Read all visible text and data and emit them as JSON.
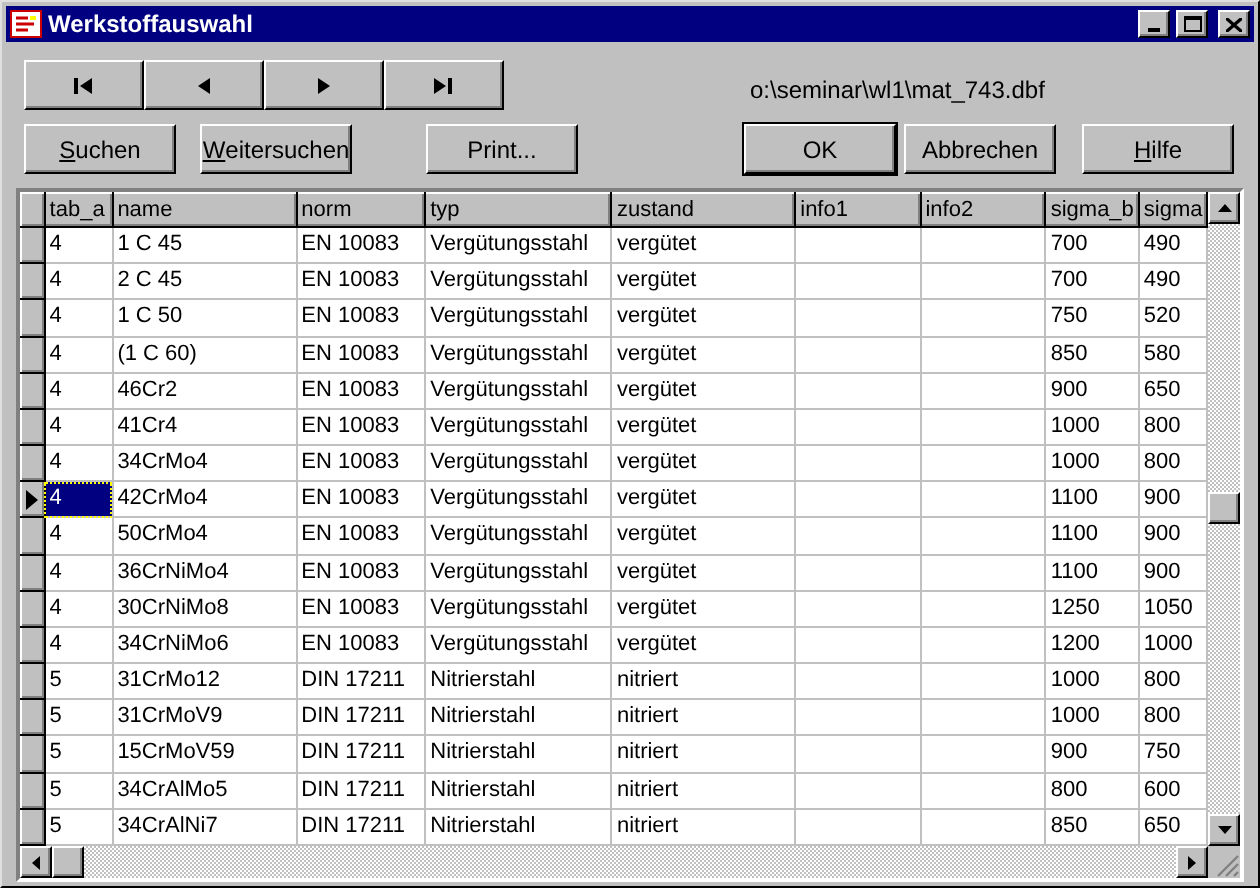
{
  "window": {
    "title": "Werkstoffauswahl"
  },
  "nav_buttons": [
    {
      "kind": "first"
    },
    {
      "kind": "prev"
    },
    {
      "kind": "next"
    },
    {
      "kind": "last"
    }
  ],
  "file_path": "o:\\seminar\\wl1\\mat_743.dbf",
  "left_buttons": [
    {
      "accel": "S",
      "rest": "uchen",
      "default": false
    },
    {
      "accel": "W",
      "rest": "eitersuchen",
      "default": false
    },
    {
      "rest": "Print...",
      "default": false
    }
  ],
  "right_buttons": [
    {
      "rest": "OK",
      "default": true
    },
    {
      "rest": "Abbrechen",
      "default": false
    },
    {
      "accel": "H",
      "rest": "ilfe",
      "default": false
    }
  ],
  "table": {
    "columns": [
      "tab_a",
      "name",
      "norm",
      "typ",
      "zustand",
      "info1",
      "info2",
      "sigma_b",
      "sigma"
    ],
    "rows": [
      {
        "selected": false,
        "cells": [
          "4",
          "1 C 45",
          "EN 10083",
          "Vergütungsstahl",
          "vergütet",
          "",
          "",
          "700",
          "490"
        ]
      },
      {
        "selected": false,
        "cells": [
          "4",
          "2 C 45",
          "EN 10083",
          "Vergütungsstahl",
          "vergütet",
          "",
          "",
          "700",
          "490"
        ]
      },
      {
        "selected": false,
        "cells": [
          "4",
          "1 C 50",
          "EN 10083",
          "Vergütungsstahl",
          "vergütet",
          "",
          "",
          "750",
          "520"
        ]
      },
      {
        "selected": false,
        "cells": [
          "4",
          "(1 C 60)",
          "EN 10083",
          "Vergütungsstahl",
          "vergütet",
          "",
          "",
          "850",
          "580"
        ]
      },
      {
        "selected": false,
        "cells": [
          "4",
          "46Cr2",
          "EN 10083",
          "Vergütungsstahl",
          "vergütet",
          "",
          "",
          "900",
          "650"
        ]
      },
      {
        "selected": false,
        "cells": [
          "4",
          "41Cr4",
          "EN 10083",
          "Vergütungsstahl",
          "vergütet",
          "",
          "",
          "1000",
          "800"
        ]
      },
      {
        "selected": false,
        "cells": [
          "4",
          "34CrMo4",
          "EN 10083",
          "Vergütungsstahl",
          "vergütet",
          "",
          "",
          "1000",
          "800"
        ]
      },
      {
        "selected": true,
        "cells": [
          "4",
          "42CrMo4",
          "EN 10083",
          "Vergütungsstahl",
          "vergütet",
          "",
          "",
          "1100",
          "900"
        ]
      },
      {
        "selected": false,
        "cells": [
          "4",
          "50CrMo4",
          "EN 10083",
          "Vergütungsstahl",
          "vergütet",
          "",
          "",
          "1100",
          "900"
        ]
      },
      {
        "selected": false,
        "cells": [
          "4",
          "36CrNiMo4",
          "EN 10083",
          "Vergütungsstahl",
          "vergütet",
          "",
          "",
          "1100",
          "900"
        ]
      },
      {
        "selected": false,
        "cells": [
          "4",
          "30CrNiMo8",
          "EN 10083",
          "Vergütungsstahl",
          "vergütet",
          "",
          "",
          "1250",
          "1050"
        ]
      },
      {
        "selected": false,
        "cells": [
          "4",
          "34CrNiMo6",
          "EN 10083",
          "Vergütungsstahl",
          "vergütet",
          "",
          "",
          "1200",
          "1000"
        ]
      },
      {
        "selected": false,
        "cells": [
          "5",
          "31CrMo12",
          "DIN 17211",
          "Nitrierstahl",
          "nitriert",
          "",
          "",
          "1000",
          "800"
        ]
      },
      {
        "selected": false,
        "cells": [
          "5",
          "31CrMoV9",
          "DIN 17211",
          "Nitrierstahl",
          "nitriert",
          "",
          "",
          "1000",
          "800"
        ]
      },
      {
        "selected": false,
        "cells": [
          "5",
          "15CrMoV59",
          "DIN 17211",
          "Nitrierstahl",
          "nitriert",
          "",
          "",
          "900",
          "750"
        ]
      },
      {
        "selected": false,
        "cells": [
          "5",
          "34CrAlMo5",
          "DIN 17211",
          "Nitrierstahl",
          "nitriert",
          "",
          "",
          "800",
          "600"
        ]
      },
      {
        "selected": false,
        "cells": [
          "5",
          "34CrAlNi7",
          "DIN 17211",
          "Nitrierstahl",
          "nitriert",
          "",
          "",
          "850",
          "650"
        ]
      }
    ]
  }
}
